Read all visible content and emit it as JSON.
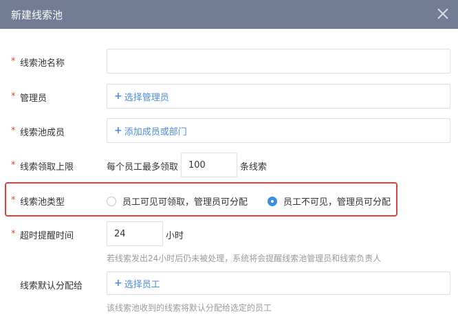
{
  "dialog": {
    "title": "新建线索池",
    "close_label": "×"
  },
  "form": {
    "required_mark": "*",
    "pool_name": {
      "label": "线索池名称",
      "value": ""
    },
    "admin": {
      "label": "管理员",
      "plus": "+",
      "link": "选择管理员"
    },
    "members": {
      "label": "线索池成员",
      "plus": "+",
      "link": "添加成员或部门"
    },
    "claim_limit": {
      "label": "线索领取上限",
      "prefix": "每个员工最多领取",
      "value": "100",
      "suffix": "条线索"
    },
    "pool_type": {
      "label": "线索池类型",
      "options": [
        {
          "label": "员工可见可领取，管理员可分配",
          "checked": false
        },
        {
          "label": "员工不可见，管理员可分配",
          "checked": true
        }
      ]
    },
    "timeout": {
      "label": "超时提醒时间",
      "value": "24",
      "unit": "小时",
      "hint": "若线索发出24小时后仍未被处理，系统将会提醒线索池管理员和线索负责人"
    },
    "default_assign": {
      "label": "线索默认分配给",
      "plus": "+",
      "link": "选择员工",
      "hint": "该线索池收到的线索将默认分配给选定的员工"
    }
  },
  "colors": {
    "header_bg": "#727d95",
    "required": "#e6462b",
    "link": "#4a8de0",
    "highlight": "#e0413a",
    "radio_checked": "#3d8fe6"
  }
}
